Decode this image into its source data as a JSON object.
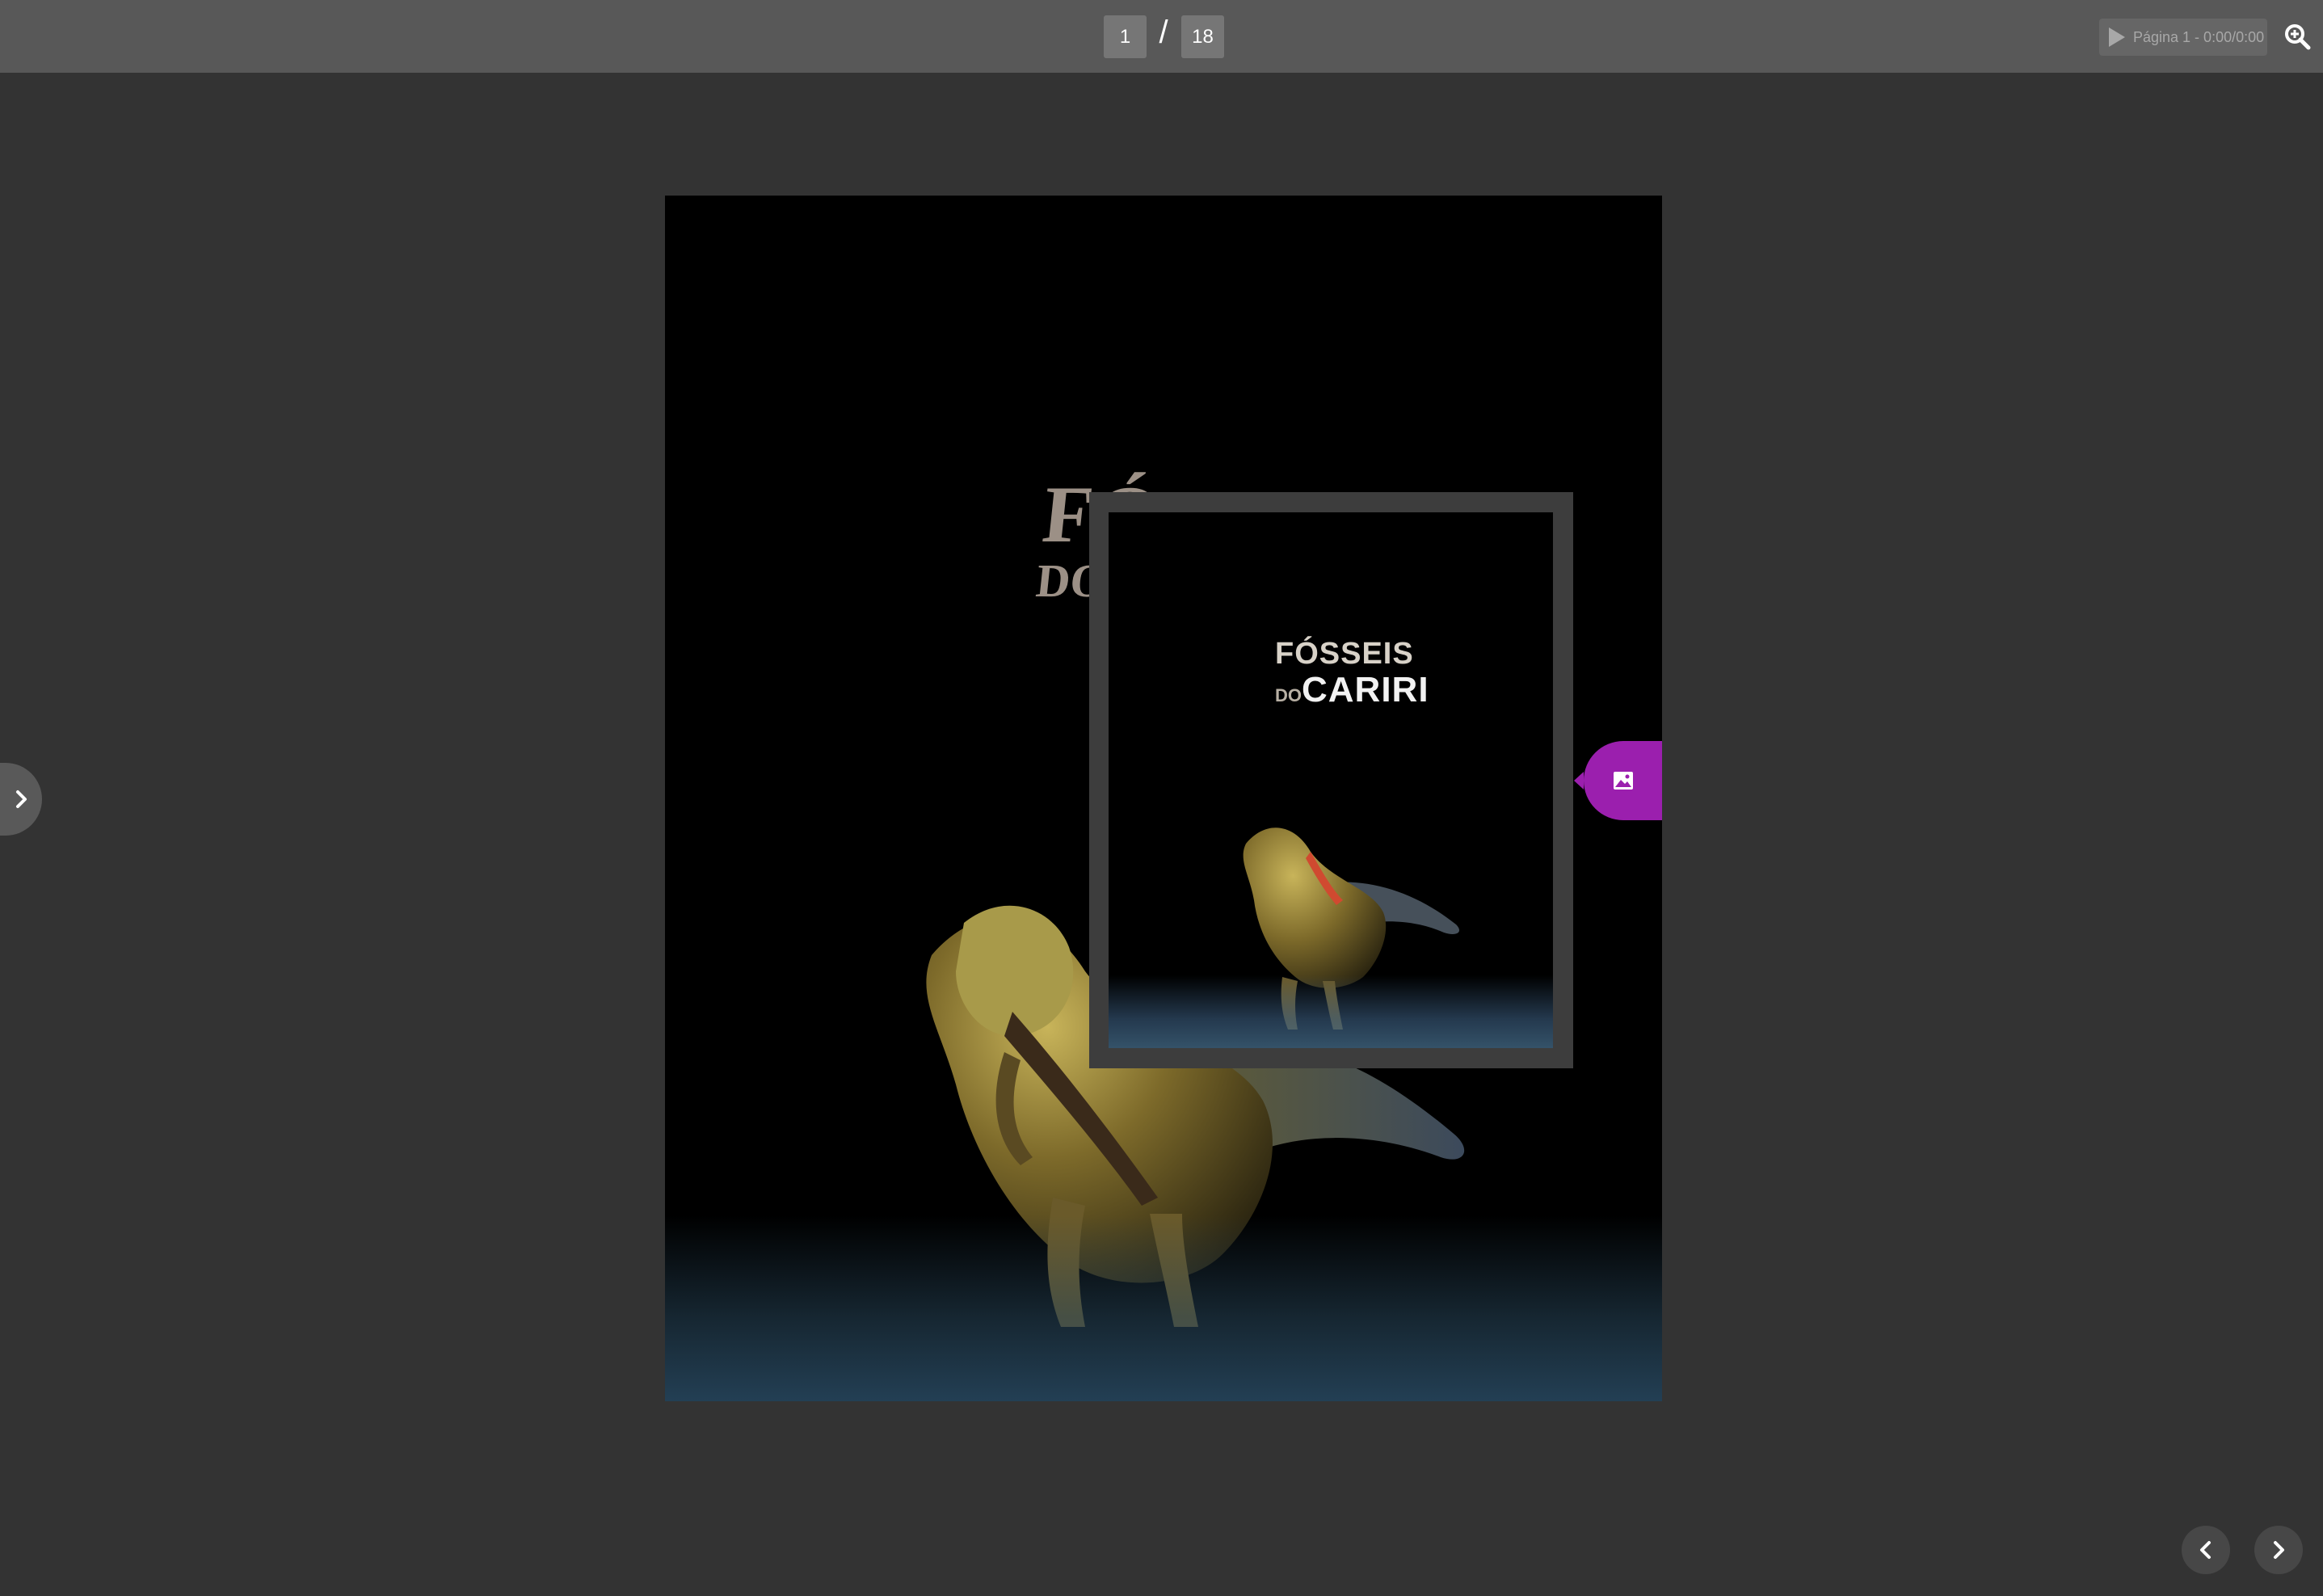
{
  "toolbar": {
    "current_page": "1",
    "separator": "/",
    "total_pages": "18",
    "audio_label": "Página 1 - 0:00/0:00"
  },
  "document": {
    "title_line1": "FÓ",
    "title_line2": "DO"
  },
  "preview": {
    "title_line1": "FÓSSEIS",
    "title_do": "DO",
    "title_line2": "CARIRI"
  },
  "icons": {
    "play": "play-icon",
    "zoom": "zoom-in-icon",
    "image": "image-icon",
    "sidebar": "chevron-right-icon",
    "prev": "chevron-left-icon",
    "next": "chevron-right-icon"
  },
  "colors": {
    "accent": "#9b1fae",
    "toolbar": "#585858",
    "background": "#333333"
  }
}
